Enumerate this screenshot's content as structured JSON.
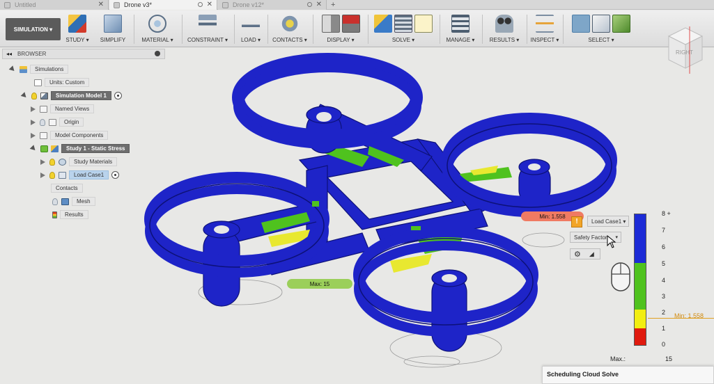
{
  "tabs": [
    {
      "label": "Untitled",
      "active": false
    },
    {
      "label": "Drone v3*",
      "active": true
    },
    {
      "label": "Drone v12*",
      "active": false
    }
  ],
  "toolbar": {
    "workspace": "SIMULATION ▾",
    "groups": [
      {
        "id": "study",
        "label": "STUDY ▾"
      },
      {
        "id": "simplify",
        "label": "SIMPLIFY"
      },
      {
        "id": "material",
        "label": "MATERIAL ▾"
      },
      {
        "id": "constraint",
        "label": "CONSTRAINT ▾"
      },
      {
        "id": "load",
        "label": "LOAD ▾"
      },
      {
        "id": "contacts",
        "label": "CONTACTS ▾"
      },
      {
        "id": "display",
        "label": "DISPLAY ▾"
      },
      {
        "id": "solve",
        "label": "SOLVE ▾"
      },
      {
        "id": "manage",
        "label": "MANAGE ▾"
      },
      {
        "id": "results",
        "label": "RESULTS ▾"
      },
      {
        "id": "inspect",
        "label": "INSPECT ▾"
      },
      {
        "id": "select",
        "label": "SELECT ▾"
      }
    ]
  },
  "browser": {
    "title": "BROWSER",
    "items": [
      {
        "label": "Simulations"
      },
      {
        "label": "Units: Custom"
      },
      {
        "label": "Simulation Model 1"
      },
      {
        "label": "Named Views"
      },
      {
        "label": "Origin"
      },
      {
        "label": "Model Components"
      },
      {
        "label": "Study 1 - Static Stress"
      },
      {
        "label": "Study Materials"
      },
      {
        "label": "Load Case1"
      },
      {
        "label": "Contacts"
      },
      {
        "label": "Mesh"
      },
      {
        "label": "Results"
      }
    ]
  },
  "viewcube": {
    "face": "RIGHT"
  },
  "viewport": {
    "min_tag": "Min: 1.558",
    "max_tag": "Max: 15"
  },
  "legend": {
    "load_case": "Load Case1 ▾",
    "result_type": "Safety Factor",
    "ticks": [
      "8 +",
      "7",
      "6",
      "5",
      "4",
      "3",
      "2",
      "1",
      "0"
    ],
    "min_marker": "Min: 1.558",
    "max_label": "Max.:",
    "max_value": "15",
    "colors": {
      "blue": "#1c2bd6",
      "green": "#4fc21e",
      "yellow": "#f2ee12",
      "red": "#e01a0e"
    }
  },
  "notification": {
    "title": "Scheduling Cloud Solve"
  },
  "model_colors": {
    "primary": "#1e24c8",
    "dark": "#0d1178",
    "stress_green": "#4fc21e",
    "stress_yellow": "#e8e830"
  }
}
